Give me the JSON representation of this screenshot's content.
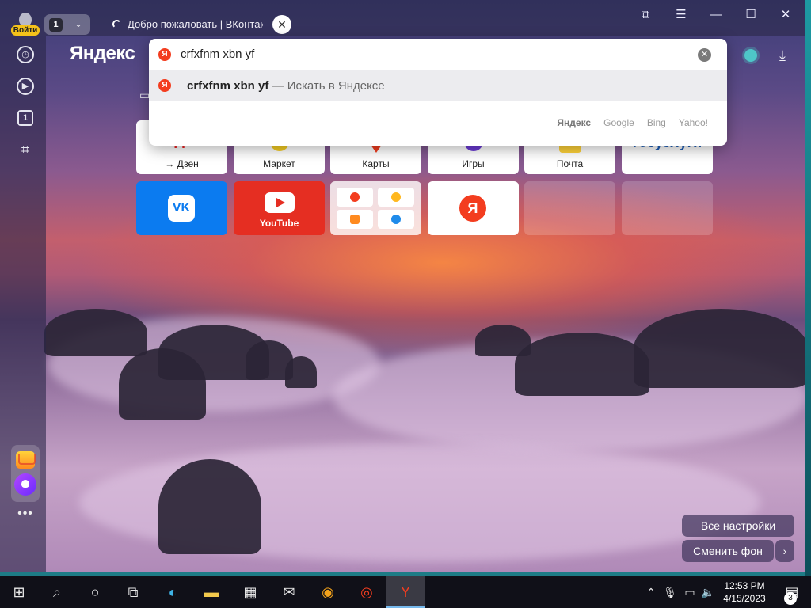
{
  "titlebar": {
    "login_label": "Войти",
    "tab_count": "1",
    "tab_title": "Добро пожаловать | ВКонтакте"
  },
  "header": {
    "logo": "Яндекс"
  },
  "omnibox": {
    "query": "crfxfnm xbn yf",
    "suggestion_bold": "crfxfnm xbn yf",
    "suggestion_rest": " — Искать в Яндексе",
    "engines": [
      "Яндекс",
      "Google",
      "Bing",
      "Yahoo!"
    ]
  },
  "tiles": {
    "row1": [
      "→ Дзен",
      "Маркет",
      "Карты",
      "Игры",
      "Почта",
      ""
    ],
    "row1_logo_first": "Яндекс",
    "row1_logo_last": "госуслуги",
    "youtube": "YouTube",
    "vk": "VK",
    "ya": "Я"
  },
  "buttons": {
    "all_settings": "Все настройки",
    "change_bg": "Сменить фон"
  },
  "taskbar": {
    "time": "12:53 PM",
    "date": "4/15/2023",
    "notifications": "3"
  },
  "colors": {
    "accent": "#f33d1f",
    "vk": "#0b7bf0",
    "youtube": "#e52e22"
  }
}
